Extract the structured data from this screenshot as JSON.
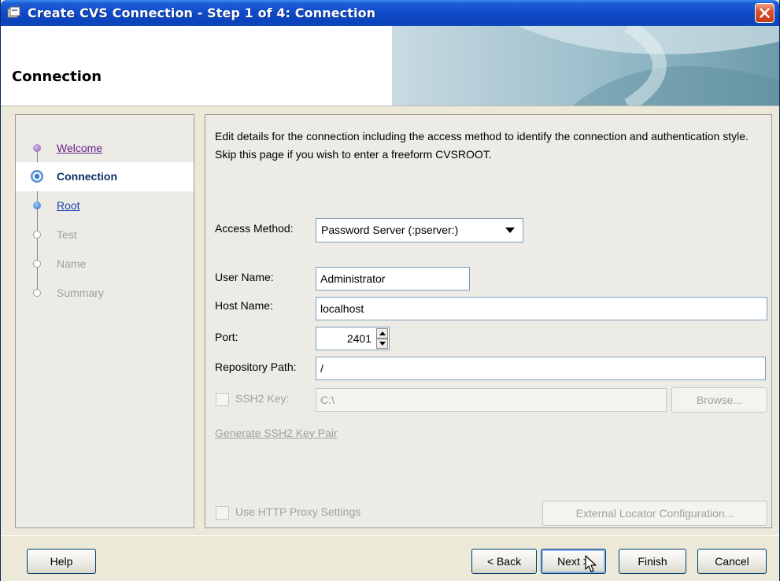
{
  "window": {
    "title": "Create CVS Connection - Step 1 of 4: Connection"
  },
  "header": {
    "title": "Connection"
  },
  "nav": {
    "items": [
      {
        "label": "Welcome",
        "state": "visited"
      },
      {
        "label": "Connection",
        "state": "current"
      },
      {
        "label": "Root",
        "state": "next"
      },
      {
        "label": "Test",
        "state": "disabled"
      },
      {
        "label": "Name",
        "state": "disabled"
      },
      {
        "label": "Summary",
        "state": "disabled"
      }
    ]
  },
  "main": {
    "description": "Edit details for the connection including the access method to identify the connection and authentication style. Skip this page if you wish to enter a freeform CVSROOT.",
    "access_method": {
      "label": "Access Method:",
      "value": "Password Server (:pserver:)"
    },
    "user_name": {
      "label": "User Name:",
      "value": "Administrator"
    },
    "host_name": {
      "label": "Host Name:",
      "value": "localhost"
    },
    "port": {
      "label": "Port:",
      "value": "2401"
    },
    "repository_path": {
      "label": "Repository Path:",
      "value": "/"
    },
    "ssh2_key": {
      "label": "SSH2 Key:",
      "value": "C:\\",
      "checked": false
    },
    "browse_label": "Browse...",
    "generate_link": "Generate SSH2 Key Pair",
    "http_proxy": {
      "label": "Use HTTP Proxy Settings",
      "checked": false
    },
    "external_locator_label": "External Locator Configuration..."
  },
  "footer": {
    "help": "Help",
    "back": "< Back",
    "next": "Next >",
    "finish": "Finish",
    "cancel": "Cancel"
  },
  "colors": {
    "titlebar": "#0a43bd",
    "dialog_bg": "#ece9d8",
    "link": "#1a3fb0",
    "visited_link": "#6a1f8a"
  }
}
